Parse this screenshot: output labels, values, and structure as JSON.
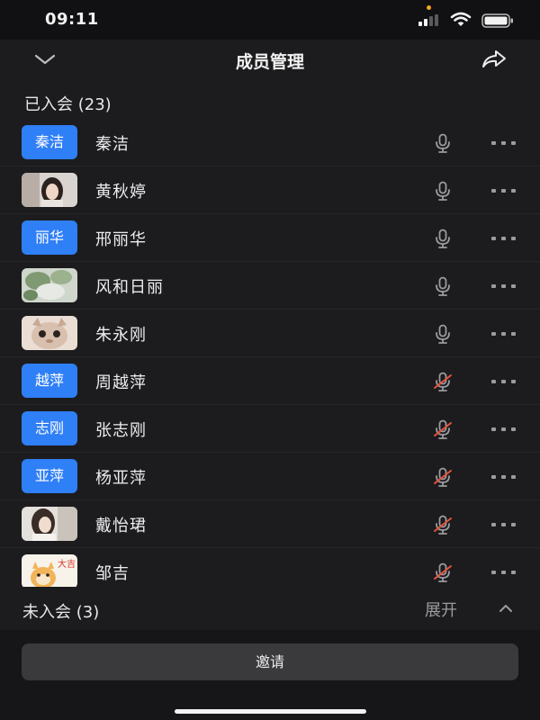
{
  "status_bar": {
    "time": "09:11"
  },
  "header": {
    "title": "成员管理",
    "back_icon": "chevron-down-icon",
    "share_icon": "share-icon"
  },
  "joined_section": {
    "label": "已入会 (23)"
  },
  "members": [
    {
      "name": "秦洁",
      "avatar_type": "text",
      "avatar_text": "秦洁",
      "mic": "on"
    },
    {
      "name": "黄秋婷",
      "avatar_type": "photo",
      "avatar_text": "",
      "mic": "on"
    },
    {
      "name": "邢丽华",
      "avatar_type": "text",
      "avatar_text": "丽华",
      "mic": "on"
    },
    {
      "name": "风和日丽",
      "avatar_type": "photo",
      "avatar_text": "",
      "mic": "on"
    },
    {
      "name": "朱永刚",
      "avatar_type": "photo",
      "avatar_text": "",
      "mic": "on"
    },
    {
      "name": "周越萍",
      "avatar_type": "text",
      "avatar_text": "越萍",
      "mic": "muted"
    },
    {
      "name": "张志刚",
      "avatar_type": "text",
      "avatar_text": "志刚",
      "mic": "muted"
    },
    {
      "name": "杨亚萍",
      "avatar_type": "text",
      "avatar_text": "亚萍",
      "mic": "muted"
    },
    {
      "name": "戴怡珺",
      "avatar_type": "photo",
      "avatar_text": "",
      "mic": "muted"
    },
    {
      "name": "邹吉",
      "avatar_type": "photo",
      "avatar_text": "大吉",
      "mic": "muted"
    }
  ],
  "not_joined_section": {
    "label": "未入会 (3)",
    "expand_label": "展开"
  },
  "invite_button": {
    "label": "邀请"
  },
  "colors": {
    "accent": "#2f7ff6",
    "muted_red": "#e5533d",
    "mic_gray": "#9b9ba0"
  }
}
